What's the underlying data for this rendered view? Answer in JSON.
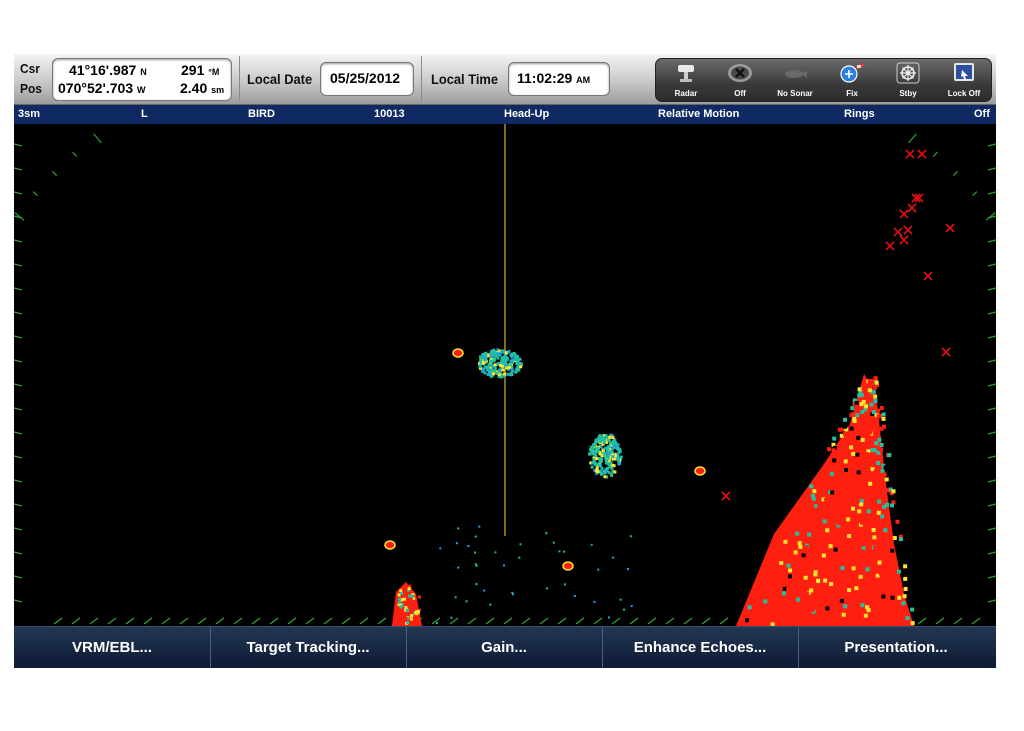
{
  "header": {
    "csr_label": "Csr",
    "pos_label": "Pos",
    "latitude": "41°16'.987",
    "lat_hemi": "N",
    "longitude": "070°52'.703",
    "lon_hemi": "W",
    "bearing": "291",
    "bearing_unit": "°M",
    "range": "2.40",
    "range_unit": "sm",
    "local_date_label": "Local Date",
    "local_date": "05/25/2012",
    "local_time_label": "Local Time",
    "local_time": "11:02:29",
    "local_time_ampm": "AM",
    "buttons": [
      {
        "label": "Radar",
        "icon": "radar-scanner-icon"
      },
      {
        "label": "Off",
        "icon": "off-icon"
      },
      {
        "label": "No Sonar",
        "icon": "fish-icon"
      },
      {
        "label": "Fix",
        "icon": "gps-fix-icon"
      },
      {
        "label": "Stby",
        "icon": "helm-wheel-icon"
      },
      {
        "label": "Lock Off",
        "icon": "touch-lock-icon"
      }
    ]
  },
  "status_strip": {
    "range": "3sm",
    "mode": "L",
    "preset": "BIRD",
    "value": "10013",
    "orientation": "Head-Up",
    "motion": "Relative Motion",
    "rings_label": "Rings",
    "rings_value": "Off"
  },
  "softkeys": [
    "VRM/EBL...",
    "Target Tracking...",
    "Gain...",
    "Enhance Echoes...",
    "Presentation..."
  ],
  "colors": {
    "heading_line": "#d8b13a",
    "echo_strong": "#ff1f10",
    "echo_medium": "#ffe52e",
    "echo_weak": "#20c0a0",
    "echo_faint": "#1aa8d6",
    "target_marker": "#e01010",
    "bearing_tick": "#2e9e2e"
  },
  "targets_count": 14
}
